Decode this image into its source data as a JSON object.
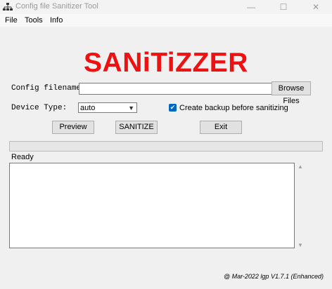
{
  "window": {
    "title": "Config file Sanitizer Tool",
    "minimize": "—",
    "maximize": "☐",
    "close": "✕"
  },
  "menu": {
    "items": [
      "File",
      "Tools",
      "Info"
    ]
  },
  "logo_text": "SANiTiZZER",
  "config": {
    "label": "Config filename",
    "value": "",
    "browse_label": "Browse Files"
  },
  "device": {
    "label": "Device Type:",
    "selected": "auto"
  },
  "backup": {
    "label": "Create backup before sanitizing",
    "checked": true
  },
  "buttons": {
    "preview": "Preview",
    "sanitize": "SANITIZE",
    "exit": "Exit"
  },
  "progress": {
    "value": 0
  },
  "status": "Ready",
  "log_text": "",
  "footer": "@ Mar-2022 lgp V1.7.1 (Enhanced)"
}
